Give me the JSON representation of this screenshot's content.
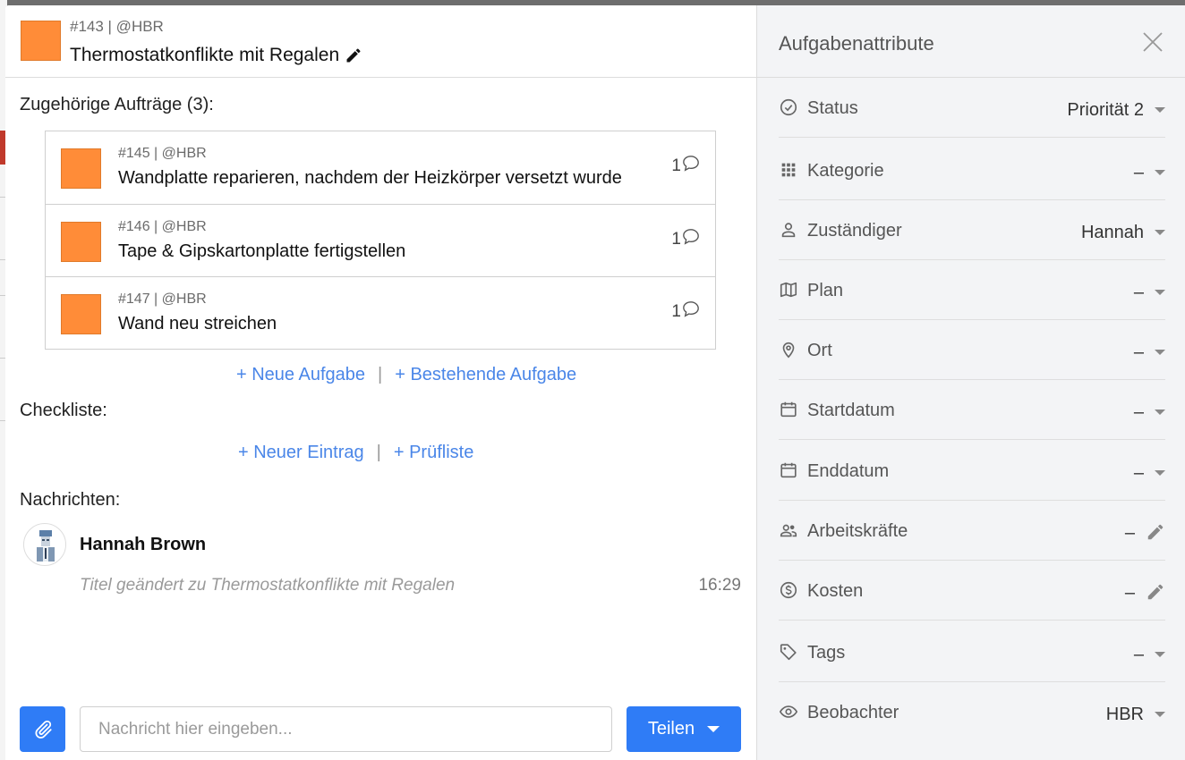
{
  "task": {
    "meta": "#143 | @HBR",
    "title": "Thermostatkonflikte mit Regalen"
  },
  "related": {
    "label": "Zugehörige Aufträge (3):",
    "items": [
      {
        "meta": "#145 | @HBR",
        "title": "Wandplatte reparieren, nachdem der Heizkörper versetzt wurde",
        "comments": "1"
      },
      {
        "meta": "#146 | @HBR",
        "title": "Tape & Gipskartonplatte fertigstellen",
        "comments": "1"
      },
      {
        "meta": "#147 | @HBR",
        "title": "Wand neu streichen",
        "comments": "1"
      }
    ],
    "new_task": "+ Neue Aufgabe",
    "existing_task": "+ Bestehende Aufgabe",
    "separator": "|"
  },
  "checklist": {
    "label": "Checkliste:",
    "new_entry": "+ Neuer Eintrag",
    "checklist_link": "+ Prüfliste",
    "separator": "|"
  },
  "messages": {
    "label": "Nachrichten:",
    "items": [
      {
        "author": "Hannah Brown",
        "text": "Titel geändert zu Thermostatkonflikte mit Regalen",
        "time": "16:29"
      }
    ]
  },
  "composer": {
    "placeholder": "Nachricht hier eingeben...",
    "share_label": "Teilen"
  },
  "sidebar": {
    "title": "Aufgabenattribute",
    "attributes": [
      {
        "icon": "check-circle-icon",
        "label": "Status",
        "value": "Priorität 2",
        "control": "dropdown"
      },
      {
        "icon": "grid-icon",
        "label": "Kategorie",
        "value": "–",
        "control": "dropdown"
      },
      {
        "icon": "person-icon",
        "label": "Zuständiger",
        "value": "Hannah",
        "control": "dropdown"
      },
      {
        "icon": "map-icon",
        "label": "Plan",
        "value": "–",
        "control": "dropdown"
      },
      {
        "icon": "location-pin-icon",
        "label": "Ort",
        "value": "–",
        "control": "dropdown"
      },
      {
        "icon": "calendar-icon",
        "label": "Startdatum",
        "value": "–",
        "control": "dropdown"
      },
      {
        "icon": "calendar-icon",
        "label": "Enddatum",
        "value": "–",
        "control": "dropdown"
      },
      {
        "icon": "people-icon",
        "label": "Arbeitskräfte",
        "value": "–",
        "control": "edit"
      },
      {
        "icon": "dollar-circle-icon",
        "label": "Kosten",
        "value": "–",
        "control": "edit"
      },
      {
        "icon": "tag-icon",
        "label": "Tags",
        "value": "–",
        "control": "dropdown"
      },
      {
        "icon": "eye-icon",
        "label": "Beobachter",
        "value": "HBR",
        "control": "dropdown"
      }
    ]
  },
  "colors": {
    "task_swatch": "#ff8c38",
    "accent": "#2f7cf6",
    "link": "#4a86e8"
  }
}
